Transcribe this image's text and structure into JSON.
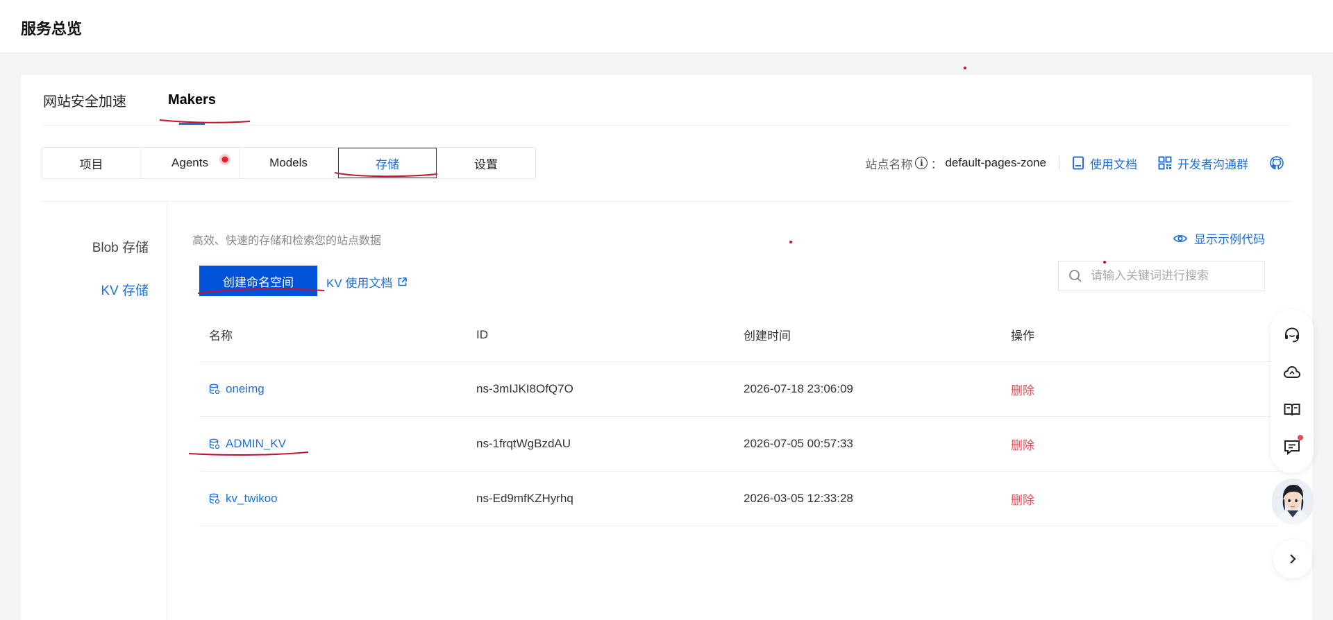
{
  "page": {
    "title": "服务总览"
  },
  "main_tabs": [
    {
      "label": "网站安全加速",
      "active": false
    },
    {
      "label": "Makers",
      "active": true
    }
  ],
  "sub_tabs": [
    {
      "label": "项目"
    },
    {
      "label": "Agents"
    },
    {
      "label": "Models"
    },
    {
      "label": "存储",
      "active": true
    },
    {
      "label": "设置"
    }
  ],
  "toolbar": {
    "zone_label": "站点名称",
    "zone_colon": "：",
    "zone_value": "default-pages-zone",
    "docs_label": "使用文档",
    "dev_group_label": "开发者沟通群"
  },
  "side_nav": [
    {
      "label": "Blob 存储",
      "active": false
    },
    {
      "label": "KV 存储",
      "active": true
    }
  ],
  "kv": {
    "description": "高效、快速的存储和检索您的站点数据",
    "show_code_label": "显示示例代码",
    "create_button_label": "创建命名空间",
    "doc_link_label": "KV 使用文档",
    "search_placeholder": "请输入关键词进行搜索"
  },
  "table": {
    "headers": {
      "name": "名称",
      "id": "ID",
      "created": "创建时间",
      "actions": "操作"
    },
    "rows": [
      {
        "name": "oneimg",
        "id": "ns-3mIJKI8OfQ7O",
        "created": "2026-07-18 23:06:09",
        "action": "删除"
      },
      {
        "name": "ADMIN_KV",
        "id": "ns-1frqtWgBzdAU",
        "created": "2026-07-05 00:57:33",
        "action": "删除"
      },
      {
        "name": "kv_twikoo",
        "id": "ns-Ed9mfKZHyrhq",
        "created": "2026-03-05 12:33:28",
        "action": "删除"
      }
    ]
  },
  "colors": {
    "accent": "#1f6fd6",
    "primary_button": "#0052d9",
    "danger": "#e34d59",
    "annotation": "#c8102e"
  }
}
